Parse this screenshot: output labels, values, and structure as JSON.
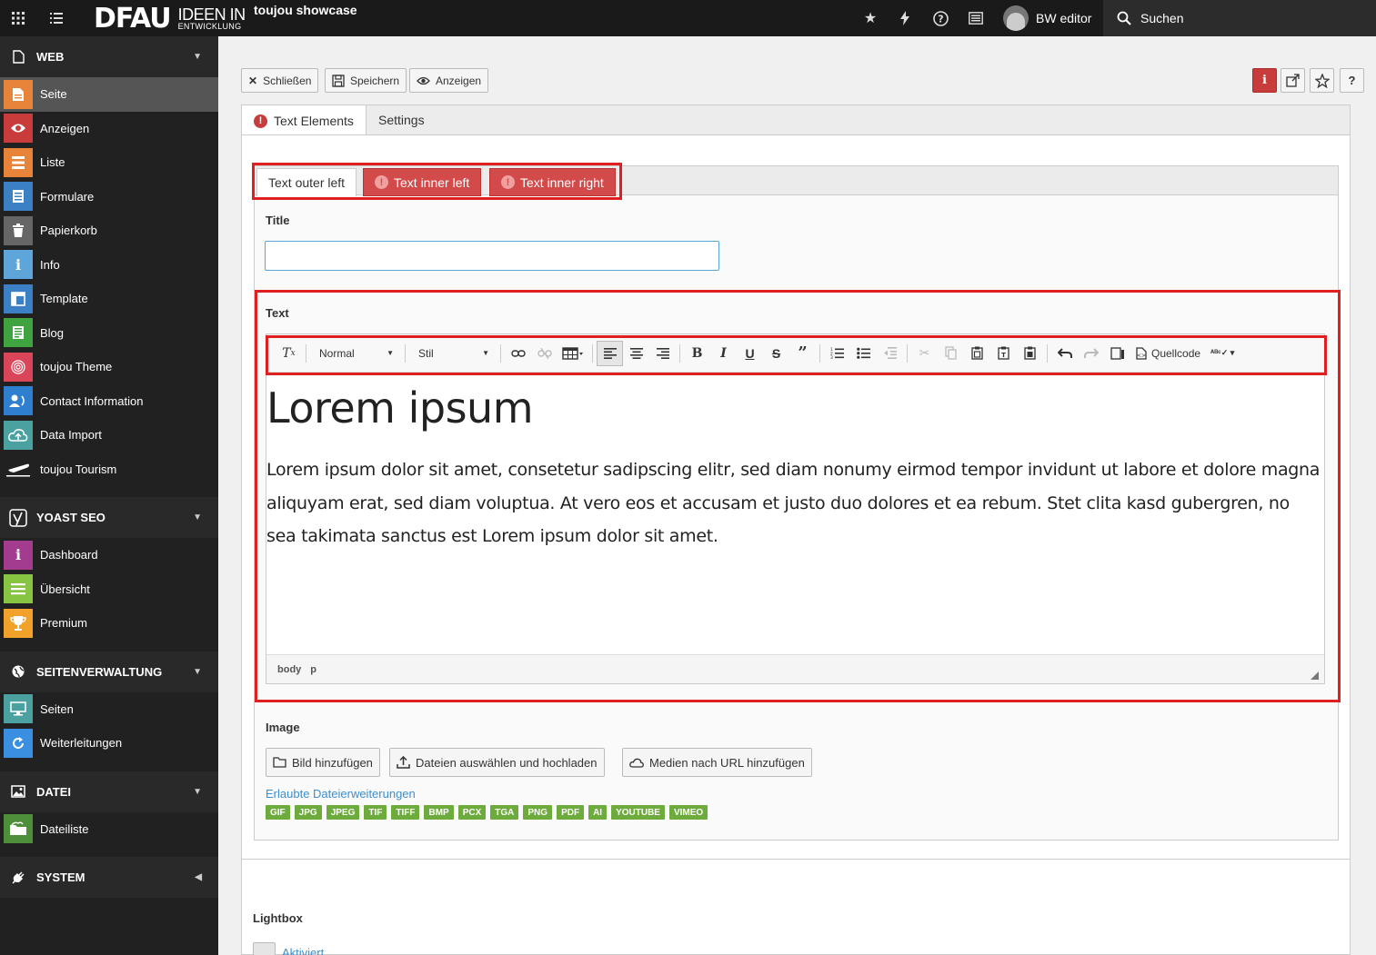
{
  "topbar": {
    "logo_main": "DFAU",
    "logo_line1": "IDEEN IN",
    "logo_line2": "ENTWICKLUNG",
    "site_name": "toujou showcase",
    "user_name": "BW editor",
    "search_label": "Suchen",
    "icons": [
      "apps-icon",
      "list-icon",
      "star-icon",
      "bolt-icon",
      "help-icon",
      "news-icon",
      "search-icon"
    ]
  },
  "sidebar": {
    "sections": [
      {
        "label": "WEB",
        "items": [
          {
            "label": "Seite",
            "color": "#e8833a",
            "icon": "page-icon",
            "active": true
          },
          {
            "label": "Anzeigen",
            "color": "#c83c3c",
            "icon": "eye-icon"
          },
          {
            "label": "Liste",
            "color": "#e8833a",
            "icon": "list-icon"
          },
          {
            "label": "Formulare",
            "color": "#3b7fc4",
            "icon": "form-icon"
          },
          {
            "label": "Papierkorb",
            "color": "#666666",
            "icon": "trash-icon"
          },
          {
            "label": "Info",
            "color": "#5ea6d9",
            "icon": "info-icon"
          },
          {
            "label": "Template",
            "color": "#3b7fc4",
            "icon": "template-icon"
          },
          {
            "label": "Blog",
            "color": "#3fa33f",
            "icon": "blog-icon"
          },
          {
            "label": "toujou Theme",
            "color": "#d9465a",
            "icon": "fingerprint-icon"
          },
          {
            "label": "Contact Information",
            "color": "#2f7fd1",
            "icon": "contacts-icon"
          },
          {
            "label": "Data Import",
            "color": "#4aa1a0",
            "icon": "cloud-upload-icon"
          },
          {
            "label": "toujou Tourism",
            "color": "#212121",
            "icon": "plane-icon"
          }
        ]
      },
      {
        "label": "YOAST SEO",
        "items": [
          {
            "label": "Dashboard",
            "color": "#a33c8f",
            "icon": "info-icon"
          },
          {
            "label": "Übersicht",
            "color": "#86c441",
            "icon": "overview-icon"
          },
          {
            "label": "Premium",
            "color": "#f2a22a",
            "icon": "trophy-icon"
          }
        ]
      },
      {
        "label": "SEITENVERWALTUNG",
        "items": [
          {
            "label": "Seiten",
            "color": "#4aa1a0",
            "icon": "monitor-icon"
          },
          {
            "label": "Weiterleitungen",
            "color": "#3b8fe0",
            "icon": "redirect-icon"
          }
        ]
      },
      {
        "label": "DATEI",
        "items": [
          {
            "label": "Dateiliste",
            "color": "#4e8f3a",
            "icon": "files-icon"
          }
        ]
      },
      {
        "label": "SYSTEM",
        "items": []
      }
    ]
  },
  "docheader": {
    "close_label": "Schließen",
    "save_label": "Speichern",
    "view_label": "Anzeigen"
  },
  "tabs": {
    "main": [
      "Text Elements",
      "Settings"
    ],
    "sub": [
      "Text outer left",
      "Text inner left",
      "Text inner right"
    ]
  },
  "form": {
    "title_label": "Title",
    "title_value": "",
    "text_label": "Text",
    "image_label": "Image",
    "lightbox_label": "Lightbox",
    "lightbox_checkbox_label": "Aktiviert"
  },
  "editor": {
    "format_value": "Normal",
    "style_value": "Stil",
    "source_label": "Quellcode",
    "heading": "Lorem ipsum",
    "paragraph": "Lorem ipsum dolor sit amet, consetetur sadipscing elitr, sed diam nonumy eirmod tempor invidunt ut labore et dolore magna aliquyam erat, sed diam voluptua. At vero eos et accusam et justo duo dolores et ea rebum. Stet clita kasd gubergren, no sea takimata sanctus est Lorem ipsum dolor sit amet.",
    "path": [
      "body",
      "p"
    ]
  },
  "image": {
    "buttons": [
      "Bild hinzufügen",
      "Dateien auswählen und hochladen",
      "Medien nach URL hinzufügen"
    ],
    "allowed_link": "Erlaubte Dateierweiterungen",
    "extensions": [
      "GIF",
      "JPG",
      "JPEG",
      "TIF",
      "TIFF",
      "BMP",
      "PCX",
      "TGA",
      "PNG",
      "PDF",
      "AI",
      "YOUTUBE",
      "VIMEO"
    ]
  },
  "colors": {
    "error": "#c83c3c",
    "highlight_outline": "#e02020",
    "link": "#3b8fd0",
    "extension_badge": "#6dab3c"
  }
}
